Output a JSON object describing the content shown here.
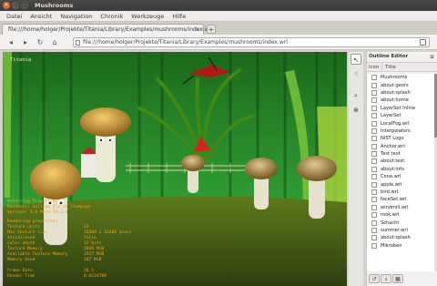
{
  "window": {
    "title": "Mushrooms",
    "close_glyph": "×",
    "minimize_glyph": "–",
    "maximize_glyph": "□"
  },
  "menubar": {
    "items": [
      "Datei",
      "Ansicht",
      "Navigation",
      "Chronik",
      "Werkzeuge",
      "Hilfe"
    ]
  },
  "tabs": [
    {
      "label": "file:///home/holger/Projekte/Titania/Library/Examples/mushrooms/index.wrl",
      "close_glyph": "×"
    }
  ],
  "new_tab_glyph": "+",
  "navbar": {
    "buttons": [
      {
        "name": "back-icon",
        "glyph": "◂"
      },
      {
        "name": "forward-icon",
        "glyph": "▸"
      },
      {
        "name": "reload-icon",
        "glyph": "↻"
      },
      {
        "name": "home-icon",
        "glyph": "⌂"
      }
    ],
    "url": "file:///home/holger/Projekte/Titania/Library/Examples/mushrooms/index.wrl"
  },
  "viewport": {
    "label": "Titania",
    "hud_header": [
      "Rendering Properties",
      "Renderer: Gallium 0.4 on llvmpipe",
      "Version: 3.0 Mesa 10.1.3"
    ],
    "hud_rows": [
      {
        "k": "Rendering properties",
        "v": ""
      },
      {
        "k": "Texture units",
        "v": "32"
      },
      {
        "k": "Max texture size",
        "v": "16384 x 16384 pixel"
      },
      {
        "k": "Antialiased",
        "v": "false"
      },
      {
        "k": "Color depth",
        "v": "32 bits"
      },
      {
        "k": "Texture Memory",
        "v": "2048 MiB"
      },
      {
        "k": "Available Texture Memory",
        "v": "1927 MiB"
      },
      {
        "k": "Memory Used",
        "v": "287 MiB"
      }
    ],
    "hud_perf": [
      {
        "k": "Frame Rate",
        "v": "26.5"
      },
      {
        "k": "Render Time",
        "v": "0.0224789"
      }
    ]
  },
  "tools": [
    {
      "name": "pointer-icon",
      "glyph": "↖",
      "active": true
    },
    {
      "name": "hand-icon",
      "glyph": "☝",
      "active": false
    },
    {
      "name": "zoom-icon",
      "glyph": "⌕",
      "active": false
    },
    {
      "name": "zoom-selection-icon",
      "glyph": "⊕",
      "active": false
    }
  ],
  "outline": {
    "title": "Outline Editor",
    "menu_glyph": "≡",
    "columns": {
      "icon": "Icon",
      "title": "Title"
    },
    "items": [
      "Mushrooms",
      "about:geors",
      "about:splash",
      "about:home",
      "LayerSet Inline",
      "LayerSet",
      "LocalFog.wrl",
      "Interpolators",
      "NIST Logo",
      "Anchor.wrl",
      "Test text",
      "about:test",
      "about:info",
      "Cone.wrl",
      "apple.wrl",
      "bird.wrl",
      "faceSet.wrl",
      "windmill.wrl",
      "rook.wrl",
      "Schacht",
      "summer.wrl",
      "about:splash",
      "Mikroben"
    ],
    "bottom_buttons": [
      "↺",
      "⇣",
      "▦"
    ]
  },
  "colors": {
    "hud": "#ffa000",
    "viewport_sky": "#2e8a2c",
    "ground": "#4a6a16",
    "mushroom_cap": "#d8a438"
  }
}
